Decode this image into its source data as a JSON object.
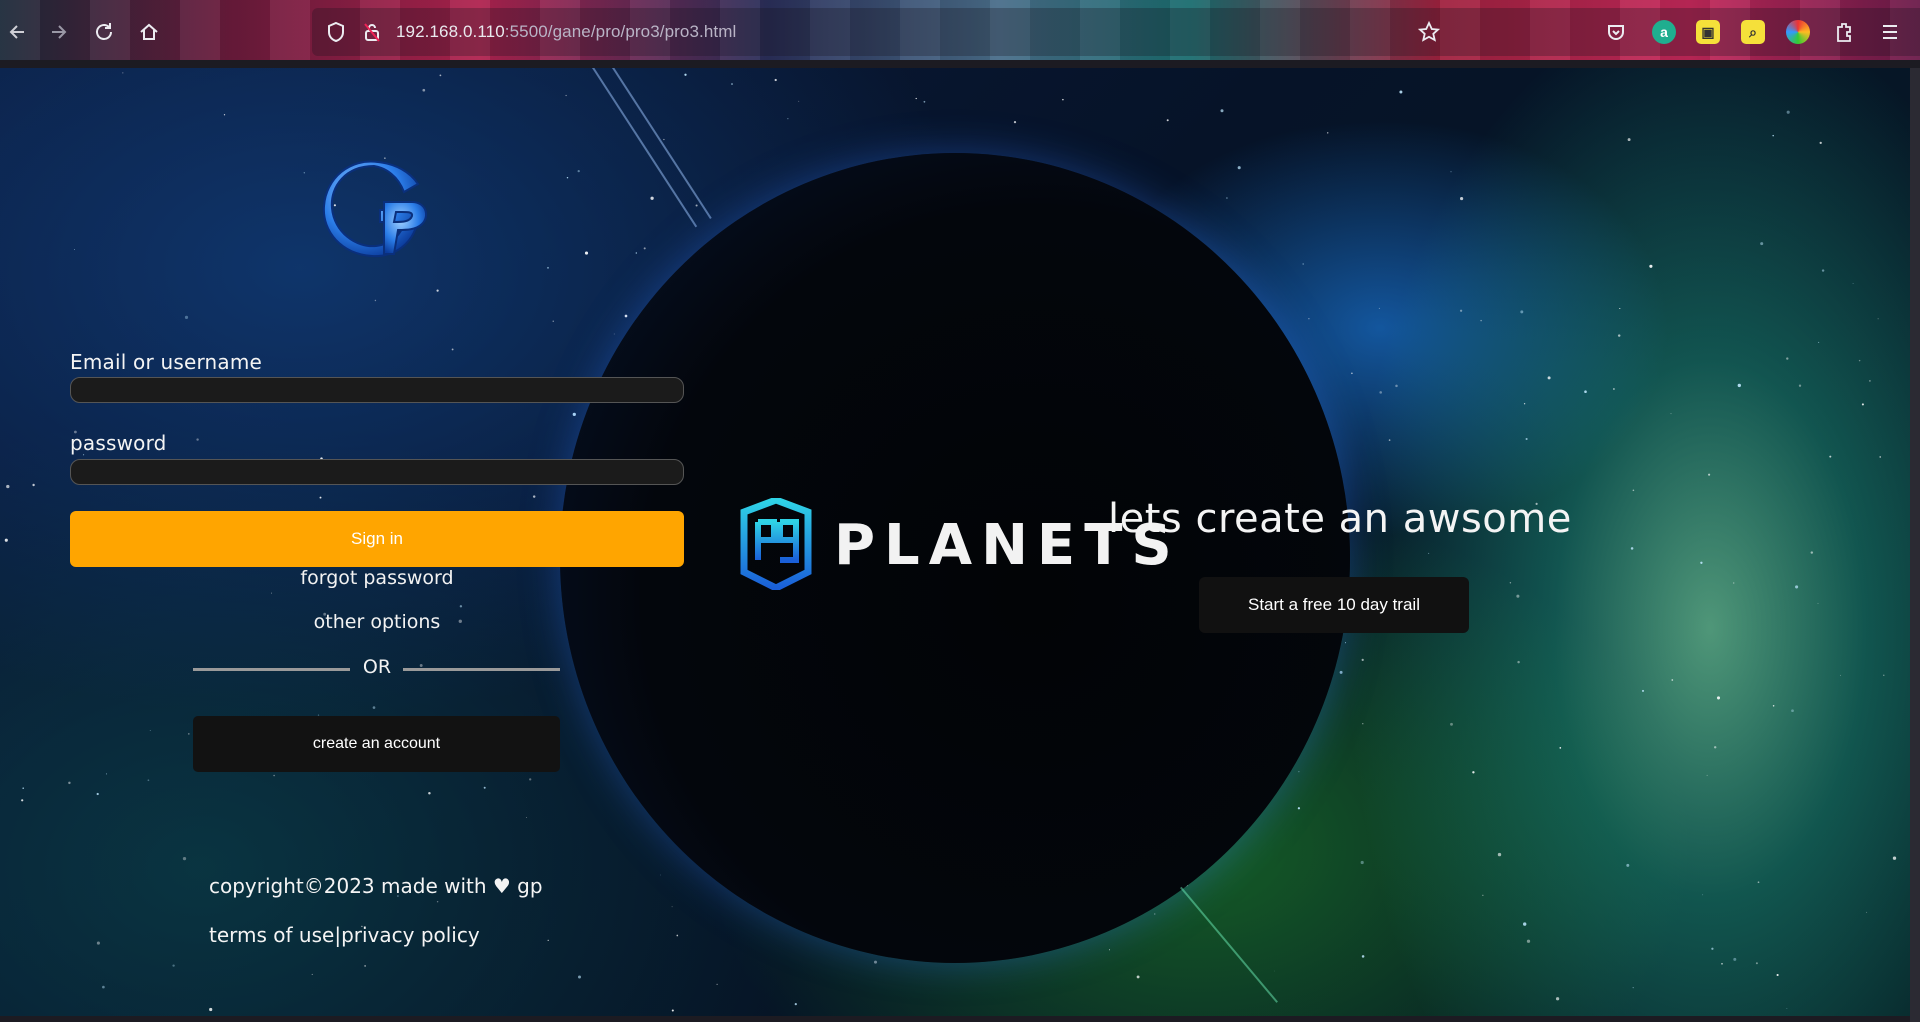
{
  "browser": {
    "url_host": "192.168.0.110",
    "url_path": ":5500/gane/pro/pro3/pro3.html",
    "icons": [
      "back-icon",
      "forward-icon",
      "reload-icon",
      "home-icon",
      "shield-icon",
      "lock-icon",
      "bookmark-star-icon",
      "pocket-icon",
      "extensions-icon",
      "menu-icon"
    ]
  },
  "login": {
    "logo_text": "Gp",
    "email_label": "Email or username",
    "email_value": "",
    "password_label": "password",
    "password_value": "",
    "signin_label": "Sign in",
    "forgot_label": "forgot password",
    "other_options_label": "other options",
    "or_label": "OR",
    "create_account_label": "create an account",
    "accent_color": "#ffa500"
  },
  "footer": {
    "copyright": "copyright©2023 made with ♥ gp",
    "terms_label": "terms of use",
    "separator": "|",
    "privacy_label": "privacy policy"
  },
  "hero": {
    "brand": "PLANETS",
    "tagline": "lets create an awsome",
    "trial_label": "Start a free 10 day trail"
  }
}
